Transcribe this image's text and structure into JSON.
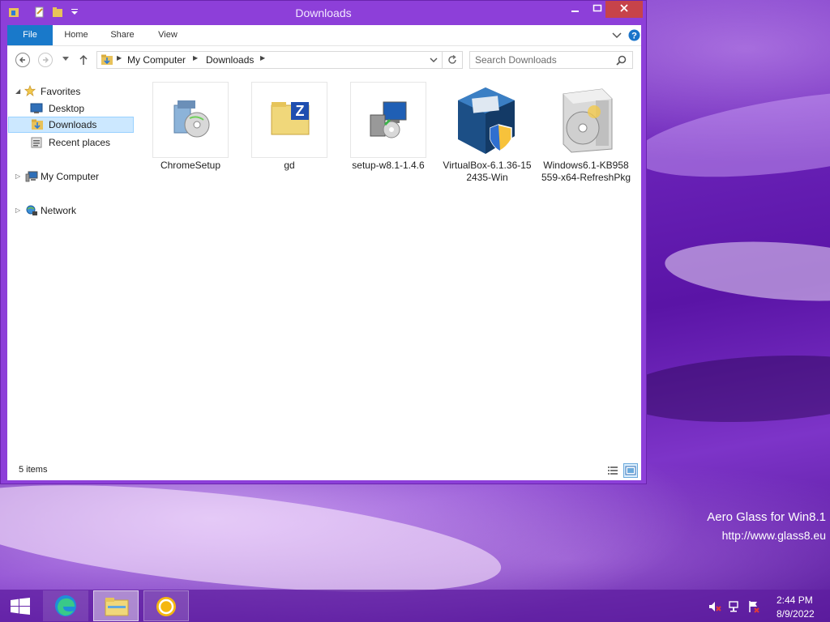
{
  "window": {
    "title": "Downloads"
  },
  "ribbon": {
    "tabs": [
      "File",
      "Home",
      "Share",
      "View"
    ]
  },
  "address": {
    "crumbs": [
      "My Computer",
      "Downloads"
    ]
  },
  "search": {
    "placeholder": "Search Downloads"
  },
  "nav": {
    "favorites": "Favorites",
    "desktop": "Desktop",
    "downloads": "Downloads",
    "recent": "Recent places",
    "computer": "My Computer",
    "network": "Network"
  },
  "files": [
    {
      "name": "ChromeSetup"
    },
    {
      "name": "gd"
    },
    {
      "name": "setup-w8.1-1.4.6"
    },
    {
      "name": "VirtualBox-6.1.36-152435-Win"
    },
    {
      "name": "Windows6.1-KB958559-x64-RefreshPkg"
    }
  ],
  "status": {
    "items": "5 items"
  },
  "watermark": {
    "line1": "Aero Glass for Win8.1",
    "line2": "http://www.glass8.eu"
  },
  "taskbar": {
    "time": "2:44 PM",
    "date": "8/9/2022"
  },
  "colors": {
    "accent": "#1979ca",
    "selection": "#cce8ff",
    "close": "#c7434a",
    "titlebar": "#8d3fd9"
  }
}
